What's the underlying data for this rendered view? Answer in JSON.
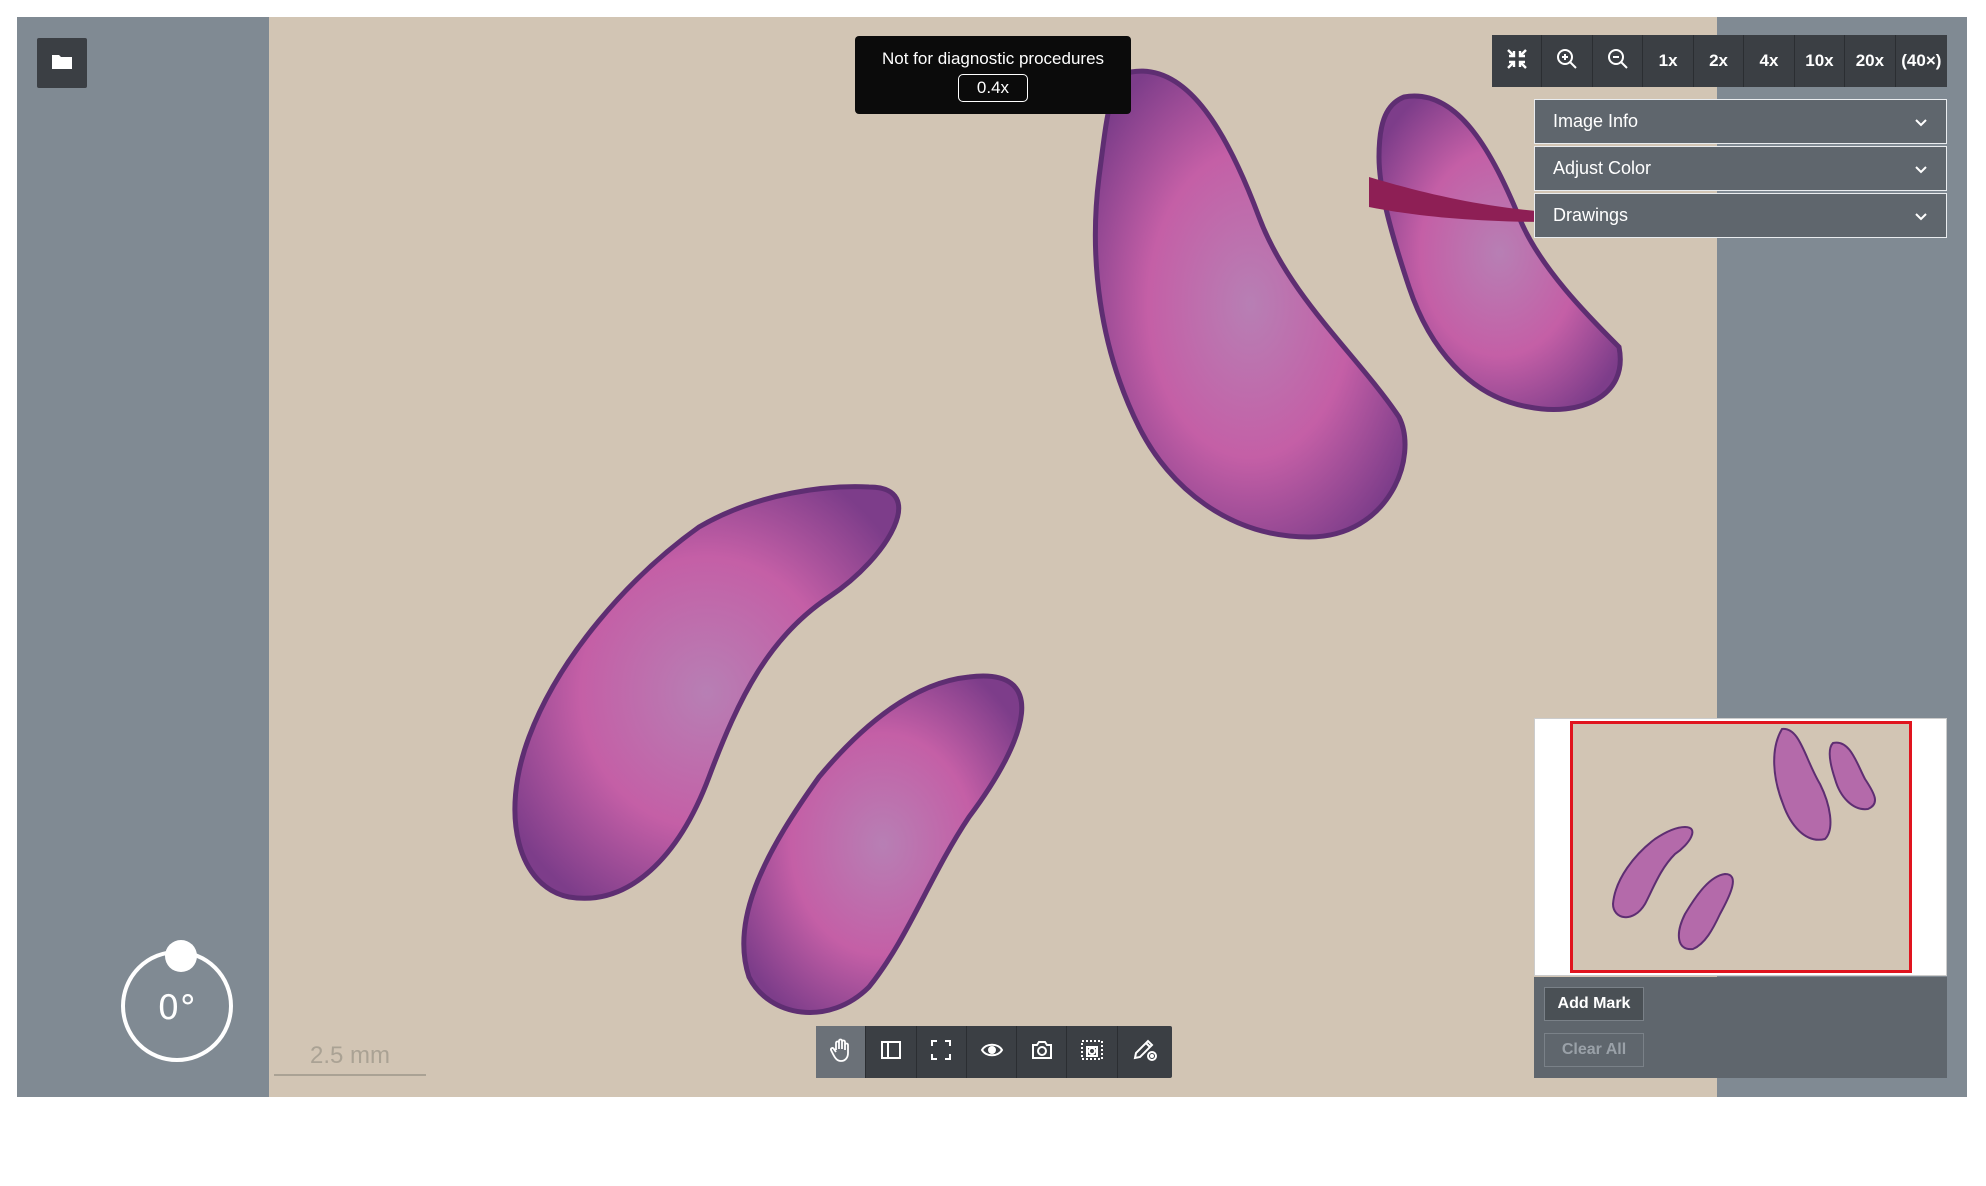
{
  "viewer": {
    "banner": {
      "warning": "Not for diagnostic procedures",
      "current_zoom": "0.4x"
    },
    "zoom_toolbar": {
      "icons": [
        "collapse-icon",
        "zoom-in-icon",
        "zoom-out-icon"
      ],
      "presets": [
        "1x",
        "2x",
        "4x",
        "10x",
        "20x",
        "(40×)"
      ]
    },
    "panels": [
      {
        "label": "Image Info"
      },
      {
        "label": "Adjust Color"
      },
      {
        "label": "Drawings"
      }
    ],
    "marks": {
      "add_label": "Add Mark",
      "clear_label": "Clear All"
    },
    "bottom_toolbar": {
      "tools": [
        "pan-hand-icon",
        "sidebar-panel-icon",
        "fullscreen-icon",
        "visibility-eye-icon",
        "camera-icon",
        "region-capture-icon",
        "annotate-pencil-icon"
      ],
      "active_tool": "pan-hand-icon"
    },
    "rotation": {
      "label": "0°"
    },
    "scale_bar": {
      "label": "2.5 mm"
    },
    "colors": {
      "background": "#808a93",
      "slide": "#d2c5b4",
      "toolbar": "#3b3f44",
      "panel": "#5f666d",
      "viewport_outline": "#e0141e",
      "tissue_pink": "#c65a9e",
      "tissue_purple": "#8a5a9e"
    }
  }
}
